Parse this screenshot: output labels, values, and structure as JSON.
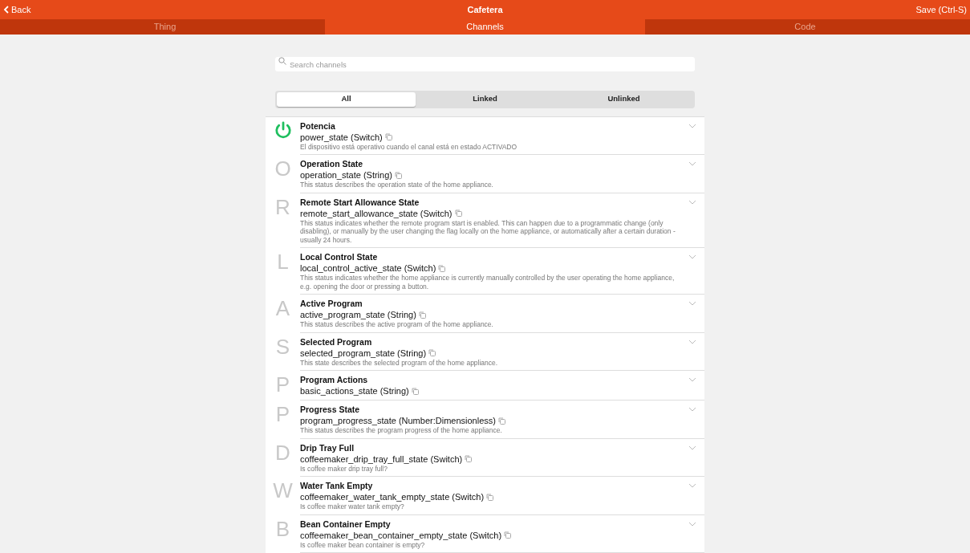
{
  "header": {
    "back": "Back",
    "title": "Cafetera",
    "save": "Save (Ctrl-S)"
  },
  "tabs": [
    {
      "label": "Thing",
      "selected": false
    },
    {
      "label": "Channels",
      "selected": true
    },
    {
      "label": "Code",
      "selected": false
    }
  ],
  "search": {
    "placeholder": "Search channels"
  },
  "filters": [
    {
      "label": "All",
      "selected": true
    },
    {
      "label": "Linked",
      "selected": false
    },
    {
      "label": "Unlinked",
      "selected": false
    }
  ],
  "channels": [
    {
      "kind": "power",
      "title": "Potencia",
      "id": "power_state (Switch)",
      "description": "El dispositivo está operativo cuando el canal está en estado ACTIVADO"
    },
    {
      "kind": "letter",
      "letter": "O",
      "title": "Operation State",
      "id": "operation_state (String)",
      "description": "This status describes the operation state of the home appliance."
    },
    {
      "kind": "letter",
      "letter": "R",
      "title": "Remote Start Allowance State",
      "id": "remote_start_allowance_state (Switch)",
      "description": "This status indicates whether the remote program start is enabled. This can happen due to a programmatic change (only disabling), or manually by the user changing the flag locally on the home appliance, or automatically after a certain duration - usually 24 hours."
    },
    {
      "kind": "letter",
      "letter": "L",
      "title": "Local Control State",
      "id": "local_control_active_state (Switch)",
      "description": "This status indicates whether the home appliance is currently manually controlled by the user operating the home appliance, e.g. opening the door or pressing a button."
    },
    {
      "kind": "letter",
      "letter": "A",
      "title": "Active Program",
      "id": "active_program_state (String)",
      "description": "This status describes the active program of the home appliance."
    },
    {
      "kind": "letter",
      "letter": "S",
      "title": "Selected Program",
      "id": "selected_program_state (String)",
      "description": "This state describes the selected program of the home appliance."
    },
    {
      "kind": "letter",
      "letter": "P",
      "title": "Program Actions",
      "id": "basic_actions_state (String)"
    },
    {
      "kind": "letter",
      "letter": "P",
      "title": "Progress State",
      "id": "program_progress_state (Number:Dimensionless)",
      "description": "This status describes the program progress of the home appliance."
    },
    {
      "kind": "letter",
      "letter": "D",
      "title": "Drip Tray Full",
      "id": "coffeemaker_drip_tray_full_state (Switch)",
      "description": "Is coffee maker drip tray full?"
    },
    {
      "kind": "letter",
      "letter": "W",
      "title": "Water Tank Empty",
      "id": "coffeemaker_water_tank_empty_state (Switch)",
      "description": "Is coffee maker water tank empty?"
    },
    {
      "kind": "letter",
      "letter": "B",
      "title": "Bean Container Empty",
      "id": "coffeemaker_bean_container_empty_state (Switch)",
      "description": "Is coffee maker bean container is empty?"
    }
  ]
}
